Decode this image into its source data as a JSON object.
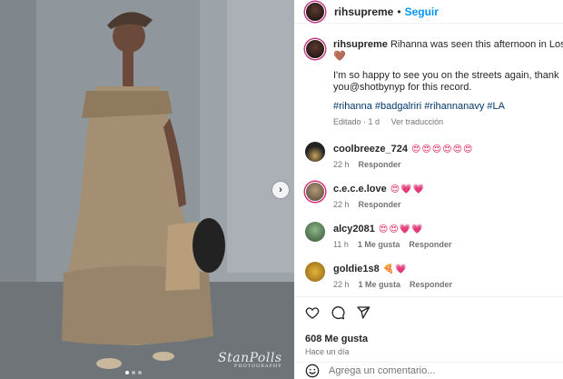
{
  "post": {
    "username": "rihsupreme",
    "separator": "•",
    "follow_label": "Seguir",
    "caption": {
      "username": "rihsupreme",
      "text": "Rihanna was seen this afternoon in Los Angeles, C",
      "emoji": "🤎",
      "line2": "I'm so happy to see you on the streets again, thank",
      "line3": "you@shotbynyp for this record.",
      "hashtags": "#rihanna #badgalriri #rihannanavy #LA",
      "edited": "Editado · 1 d",
      "translate": "Ver traducción"
    },
    "comments": [
      {
        "user": "coolbreeze_724",
        "text": "😍😍😍😍😍😍",
        "time": "22 h",
        "likes": "",
        "reply": "Responder"
      },
      {
        "user": "c.e.c.e.love",
        "text": "😍💗💗",
        "time": "22 h",
        "likes": "",
        "reply": "Responder"
      },
      {
        "user": "alcy2081",
        "text": "😍😍💗💗",
        "time": "11 h",
        "likes": "1 Me gusta",
        "reply": "Responder"
      },
      {
        "user": "goldie1s8",
        "text": "🍕💗",
        "time": "22 h",
        "likes": "1 Me gusta",
        "reply": "Responder"
      }
    ],
    "likes": "608 Me gusta",
    "posted": "Hace un día",
    "add_comment_placeholder": "Agrega un comentario...",
    "watermark": "StanPolls",
    "watermark_sub": "PHOTOGRAPHY"
  },
  "icons": {
    "like": "heart-icon",
    "comment": "comment-icon",
    "share": "paper-plane-icon",
    "emoji": "smiley-icon",
    "next": "chevron-right-icon"
  },
  "colors": {
    "link": "#0095f6",
    "hashtag": "#00376b",
    "muted": "#737373",
    "dress": "#a48f72"
  }
}
